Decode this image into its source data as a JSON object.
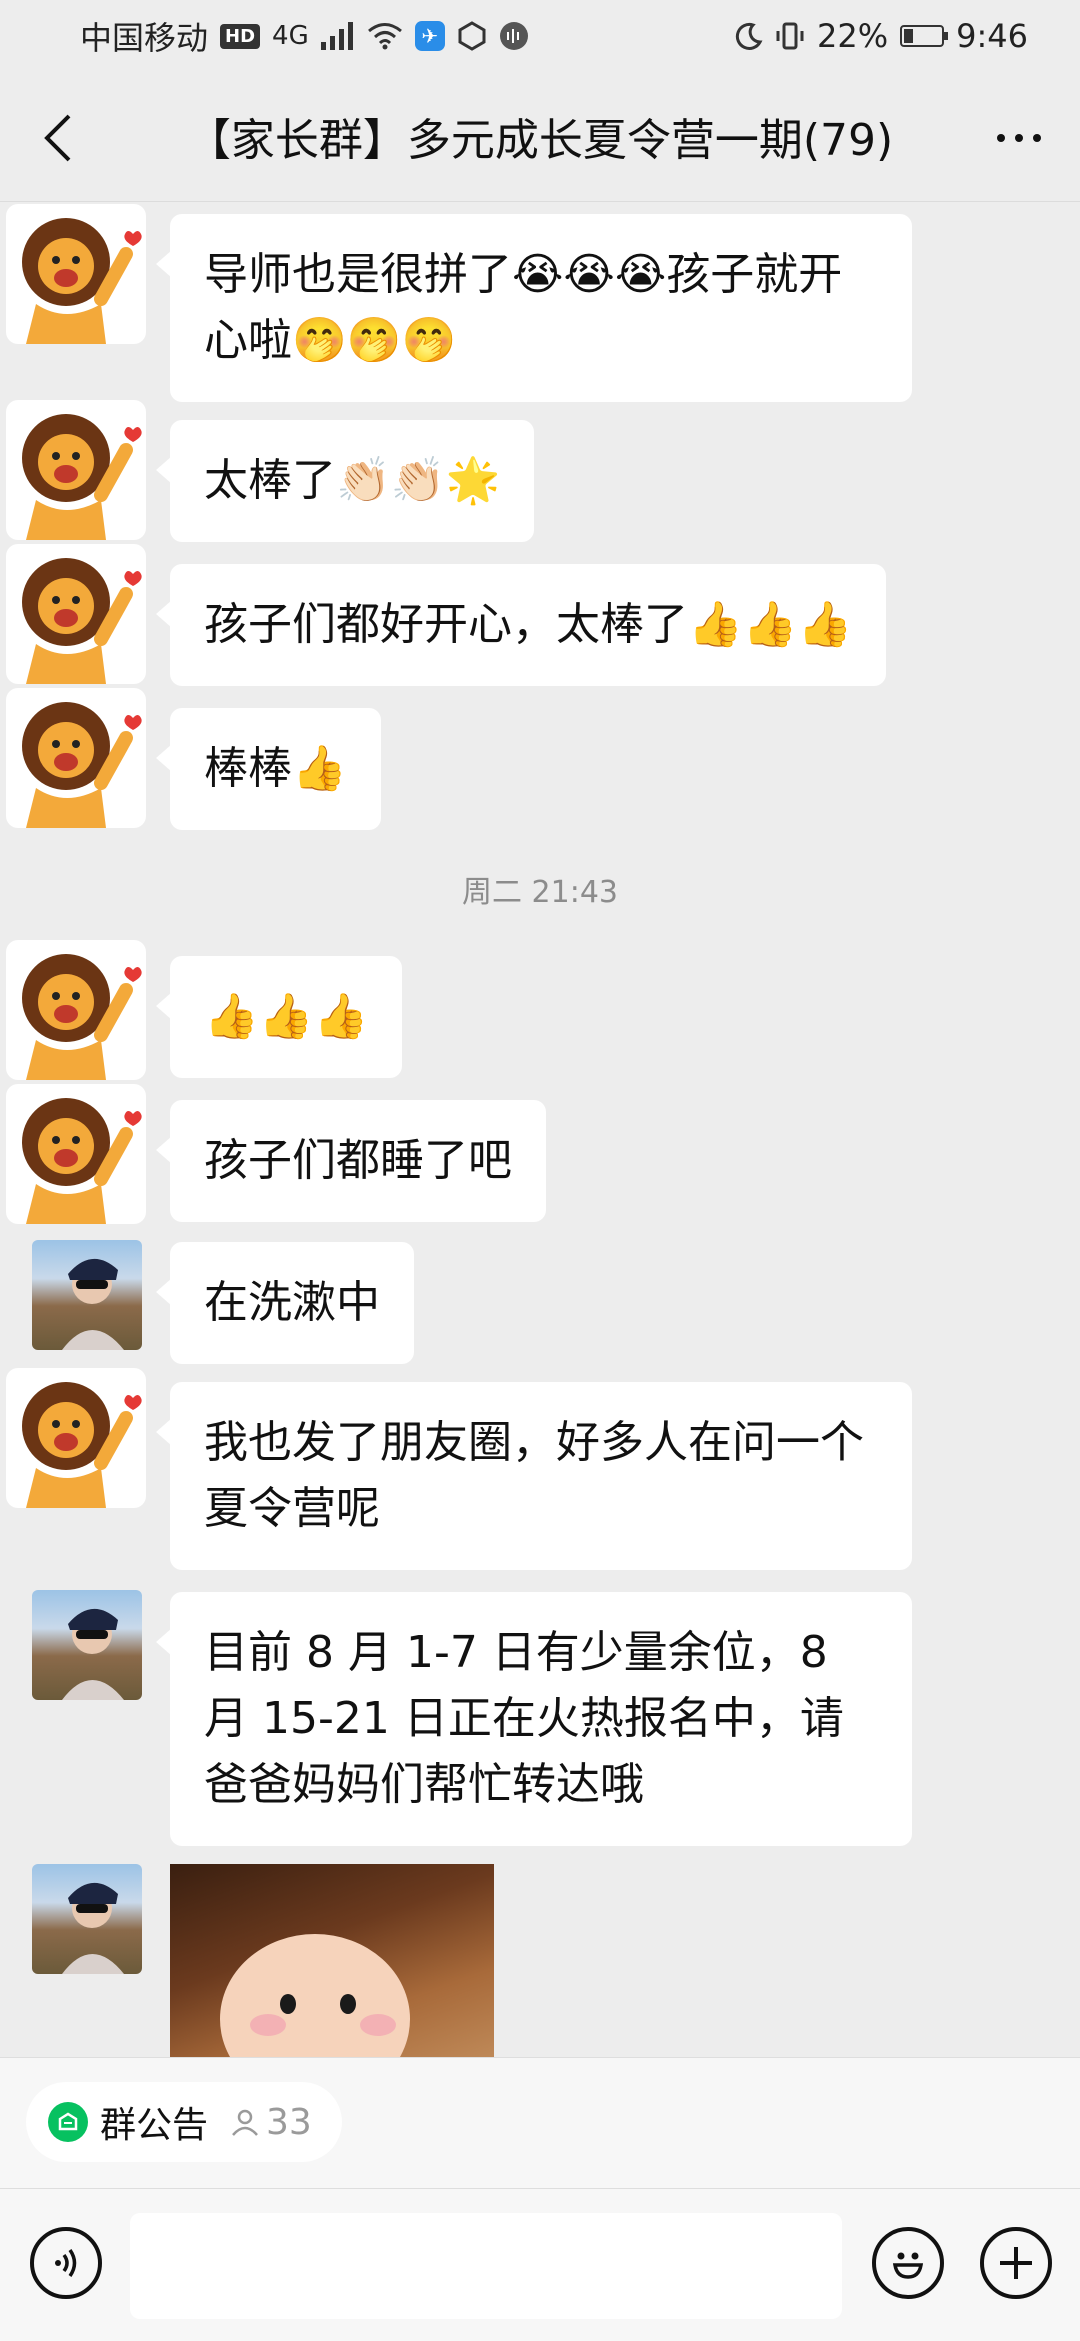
{
  "status_bar": {
    "carrier": "中国移动",
    "hd": "HD",
    "network": "4G",
    "battery": "22%",
    "time": "9:46"
  },
  "header": {
    "title": "【家长群】多元成长夏令营一期(79)"
  },
  "messages": [
    {
      "sender": "lion",
      "text": "导师也是很拼了😭😭😭孩子就开心啦🤭🤭🤭"
    },
    {
      "sender": "lion",
      "text": "太棒了👏🏻👏🏻🌟"
    },
    {
      "sender": "lion",
      "text": "孩子们都好开心，太棒了👍👍👍"
    },
    {
      "sender": "lion",
      "text": "棒棒👍"
    },
    {
      "sender": "lion",
      "text": "👍👍👍"
    },
    {
      "sender": "lion",
      "text": "孩子们都睡了吧"
    },
    {
      "sender": "photo",
      "text": "在洗漱中"
    },
    {
      "sender": "lion",
      "text": "我也发了朋友圈，好多人在问一个夏令营呢"
    },
    {
      "sender": "photo",
      "text": "目前 8 月 1-7 日有少量余位，8 月 15-21 日正在火热报名中，请爸爸妈妈们帮忙转达哦"
    }
  ],
  "timestamp": "周二 21:43",
  "notice": {
    "label": "群公告",
    "count": "33"
  },
  "colors": {
    "background": "#ededed",
    "bubble": "#ffffff",
    "accent_green": "#07c160"
  }
}
